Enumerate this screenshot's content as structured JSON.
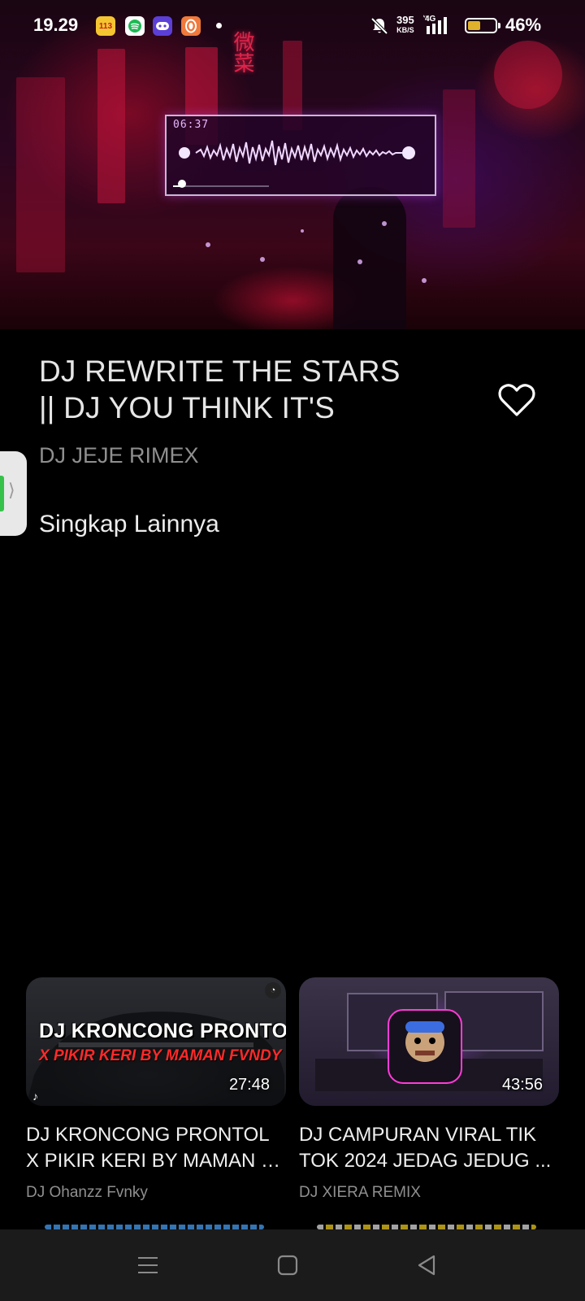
{
  "status_bar": {
    "time": "19.29",
    "apps": [
      {
        "icon": "app-badge-icon",
        "glyph": "113",
        "color": "#f5c531"
      },
      {
        "icon": "spotify-icon",
        "glyph": "≋",
        "color": "#ffffff"
      },
      {
        "icon": "game-controller-icon",
        "glyph": "◉",
        "color": "#5b3fd6"
      },
      {
        "icon": "pocket-app-icon",
        "glyph": "◯",
        "color": "#f07a3c"
      }
    ],
    "net_speed_value": "395",
    "net_speed_unit": "KB/S",
    "network_type": "4G",
    "battery_percent": "46%",
    "battery_level": 0.46
  },
  "player": {
    "time": "06:37",
    "progress": 0.09
  },
  "video": {
    "title_line1": "DJ REWRITE THE STARS",
    "title_line2": "|| DJ YOU THINK IT'S",
    "channel": "DJ JEJE RIMEX",
    "more_label": "Singkap Lainnya",
    "favorite_icon": "heart-outline-icon"
  },
  "recommendations": [
    {
      "thumb_line1": "DJ KRONCONG PRONTOL",
      "thumb_line2": "X PIKIR KERI BY MAMAN FVNDY",
      "duration": "27:48",
      "title_line1": "DJ KRONCONG PRONTOL",
      "title_line2": "X PIKIR KERI BY MAMAN F...",
      "channel": "DJ Ohanzz Fvnky"
    },
    {
      "duration": "43:56",
      "title_line1": "DJ CAMPURAN VIRAL TIK",
      "title_line2": "TOK 2024 JEDAG JEDUG ...",
      "channel": "DJ XIERA REMIX"
    }
  ],
  "nav_bar": {
    "menu_icon": "menu-icon",
    "home_icon": "home-square-icon",
    "back_icon": "back-triangle-icon"
  },
  "colors": {
    "background": "#000000",
    "title": "#e6e6e6",
    "secondary_text": "#8f8f8f",
    "nav_bar": "#1b1b1b",
    "accent_red": "#ff2a2a"
  }
}
